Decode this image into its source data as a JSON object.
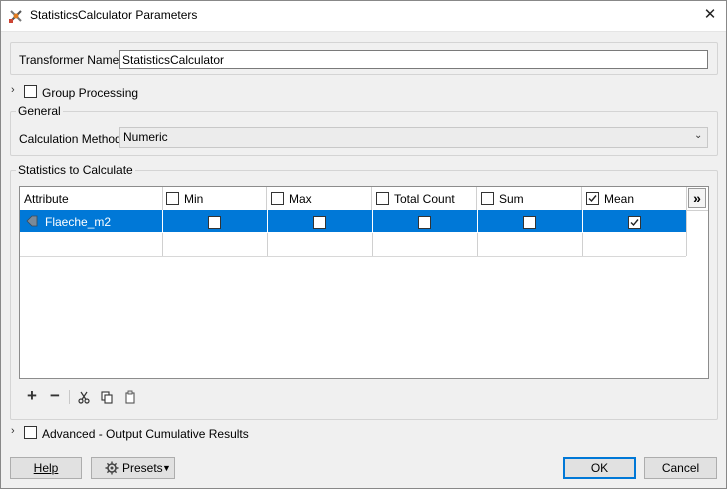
{
  "window": {
    "title": "StatisticsCalculator Parameters",
    "close_glyph": "✕"
  },
  "transformer": {
    "label": "Transformer Name:",
    "value": "StatisticsCalculator"
  },
  "group_processing": {
    "label": "Group Processing",
    "checked": false
  },
  "general": {
    "section_title": "General",
    "calc_method_label": "Calculation Method:",
    "calc_method_value": "Numeric"
  },
  "statistics": {
    "section_title": "Statistics to Calculate",
    "columns": [
      {
        "label": "Attribute",
        "has_checkbox": false
      },
      {
        "label": "Min",
        "checked": false
      },
      {
        "label": "Max",
        "checked": false
      },
      {
        "label": "Total Count",
        "checked": false
      },
      {
        "label": "Sum",
        "checked": false
      },
      {
        "label": "Mean",
        "checked": true
      }
    ],
    "more_columns_glyph": "»",
    "rows": [
      {
        "attribute": "Flaeche_m2",
        "min": false,
        "max": false,
        "total_count": false,
        "sum": false,
        "mean": true
      }
    ]
  },
  "toolbar": {
    "add": "+",
    "remove": "−",
    "cut_icon": "cut-icon",
    "copy_icon": "copy-icon",
    "paste_icon": "paste-icon"
  },
  "advanced": {
    "label": "Advanced - Output Cumulative Results",
    "checked": false
  },
  "footer": {
    "help": "Help",
    "presets": "Presets",
    "ok": "OK",
    "cancel": "Cancel"
  }
}
